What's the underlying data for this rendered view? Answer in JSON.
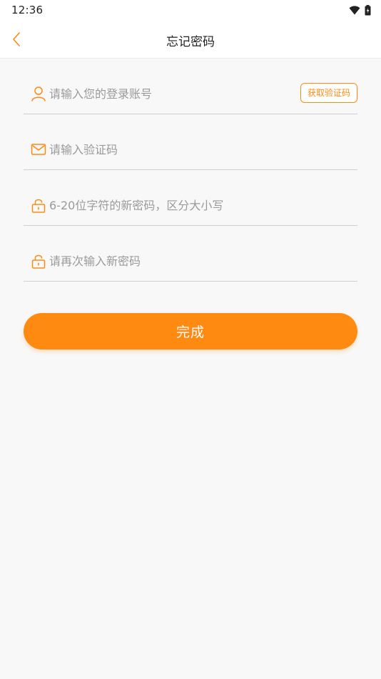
{
  "status_bar": {
    "time": "12:36",
    "icons": [
      "wifi-icon",
      "battery-icon"
    ]
  },
  "header": {
    "title": "忘记密码",
    "back_icon": "chevron-left-icon"
  },
  "form": {
    "account": {
      "placeholder": "请输入您的登录账号",
      "value": "",
      "icon": "user-icon"
    },
    "get_code_label": "获取验证码",
    "code": {
      "placeholder": "请输入验证码",
      "value": "",
      "icon": "mail-icon"
    },
    "new_password": {
      "placeholder": "6-20位字符的新密码，区分大小写",
      "value": "",
      "icon": "lock-icon"
    },
    "confirm_password": {
      "placeholder": "请再次输入新密码",
      "value": "",
      "icon": "lock-icon"
    },
    "submit_label": "完成"
  },
  "colors": {
    "accent": "#ff8a12",
    "background": "#f8f8f8",
    "divider": "#cfcfcf"
  }
}
